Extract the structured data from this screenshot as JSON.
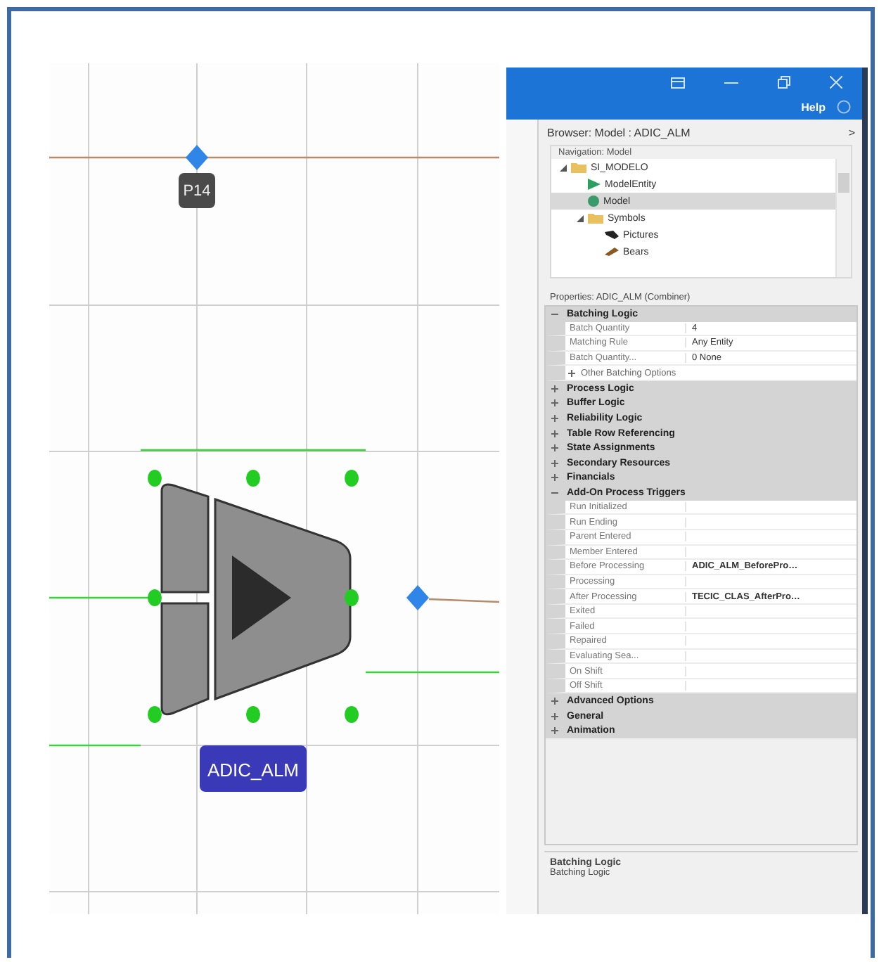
{
  "window": {
    "help": "Help"
  },
  "canvas": {
    "node": {
      "label": "P14"
    },
    "object": {
      "label": "ADIC_ALM",
      "selected": true
    }
  },
  "browser": {
    "title": "Browser: Model : ADIC_ALM",
    "arrow": ">"
  },
  "navigation": {
    "title": "Navigation: Model",
    "items": [
      {
        "label": "SI_MODELO",
        "kind": "folder",
        "expanded": true,
        "selected": false,
        "children": [
          {
            "label": "ModelEntity",
            "kind": "entity",
            "selected": false
          },
          {
            "label": "Model",
            "kind": "model",
            "selected": true
          },
          {
            "label": "Symbols",
            "kind": "folder",
            "expanded": true,
            "selected": false,
            "children": [
              {
                "label": "Pictures",
                "kind": "picture",
                "selected": false
              },
              {
                "label": "Bears",
                "kind": "shape",
                "selected": false
              }
            ]
          }
        ]
      }
    ]
  },
  "properties": {
    "title": "Properties: ADIC_ALM (Combiner)",
    "categories": [
      {
        "label": "Batching Logic",
        "expanded": true,
        "rows": [
          {
            "kind": "property",
            "name": "Batch Quantity",
            "value": "4"
          },
          {
            "kind": "property",
            "name": "Matching Rule",
            "value": "Any Entity"
          },
          {
            "kind": "property",
            "name": "Batch Quantity...",
            "value": "0 None"
          },
          {
            "kind": "group",
            "name": "Other Batching Options"
          }
        ]
      },
      {
        "label": "Process Logic",
        "expanded": false
      },
      {
        "label": "Buffer Logic",
        "expanded": false
      },
      {
        "label": "Reliability Logic",
        "expanded": false
      },
      {
        "label": "Table Row Referencing",
        "expanded": false
      },
      {
        "label": "State Assignments",
        "expanded": false
      },
      {
        "label": "Secondary Resources",
        "expanded": false
      },
      {
        "label": "Financials",
        "expanded": false
      },
      {
        "label": "Add-On Process Triggers",
        "expanded": true,
        "rows": [
          {
            "kind": "property",
            "name": "Run Initialized"
          },
          {
            "kind": "property",
            "name": "Run Ending"
          },
          {
            "kind": "property",
            "name": "Parent Entered"
          },
          {
            "kind": "property",
            "name": "Member Entered"
          },
          {
            "kind": "property",
            "name": "Before Processing",
            "value": "ADIC_ALM_BeforePro…"
          },
          {
            "kind": "property",
            "name": "Processing"
          },
          {
            "kind": "property",
            "name": "After Processing",
            "value": "TECIC_CLAS_AfterPro…"
          },
          {
            "kind": "property",
            "name": "Exited"
          },
          {
            "kind": "property",
            "name": "Failed"
          },
          {
            "kind": "property",
            "name": "Repaired"
          },
          {
            "kind": "property",
            "name": "Evaluating Sea..."
          },
          {
            "kind": "property",
            "name": "On Shift"
          },
          {
            "kind": "property",
            "name": "Off Shift"
          }
        ]
      },
      {
        "label": "Advanced Options",
        "expanded": false
      },
      {
        "label": "General",
        "expanded": false
      },
      {
        "label": "Animation",
        "expanded": false
      }
    ]
  },
  "description": {
    "title": "Batching Logic",
    "text": "Batching Logic"
  }
}
